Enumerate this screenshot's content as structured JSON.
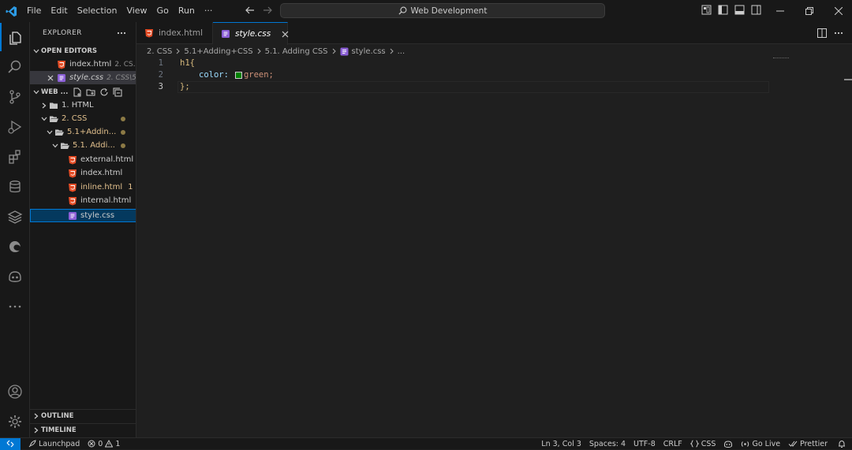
{
  "titlebar": {
    "menu": [
      "File",
      "Edit",
      "Selection",
      "View",
      "Go",
      "Run",
      "···"
    ],
    "search": "Web Development"
  },
  "sidebar": {
    "title": "EXPLORER",
    "open_editors_label": "OPEN EDITORS",
    "open_editors": [
      {
        "name": "index.html",
        "path": "2. CS..."
      },
      {
        "name": "style.css",
        "path": "2. CSS\\5..."
      }
    ],
    "workspace_label": "WEB ...",
    "tree": [
      {
        "label": "1. HTML"
      },
      {
        "label": "2. CSS"
      },
      {
        "label": "5.1+Addin..."
      },
      {
        "label": "5.1. Addi..."
      },
      {
        "label": "external.html"
      },
      {
        "label": "index.html"
      },
      {
        "label": "inline.html",
        "badge": "1"
      },
      {
        "label": "internal.html"
      },
      {
        "label": "style.css"
      }
    ],
    "outline_label": "OUTLINE",
    "timeline_label": "TIMELINE"
  },
  "tabs": [
    {
      "label": "index.html"
    },
    {
      "label": "style.css"
    }
  ],
  "breadcrumb": [
    "2. CSS",
    "5.1+Adding+CSS",
    "5.1. Adding CSS",
    "style.css",
    "..."
  ],
  "editor": {
    "line_numbers": [
      "1",
      "2",
      "3"
    ],
    "line1": "h1{",
    "property": "color:",
    "value": "green;",
    "line3": "};"
  },
  "status": {
    "launchpad": "Launchpad",
    "errors": "0",
    "warnings": "1",
    "position": "Ln 3, Col 3",
    "spaces": "Spaces: 4",
    "encoding": "UTF-8",
    "eol": "CRLF",
    "language": "CSS",
    "golive": "Go Live",
    "prettier": "Prettier"
  },
  "colors": {
    "accent": "#0078d4",
    "html_icon": "#e44d26",
    "css_icon": "#8b5fd6",
    "modified": "#e2c08d",
    "swatch": "#008000"
  },
  "icons": [
    "vscode-logo-icon",
    "files-icon",
    "search-icon",
    "source-control-icon",
    "run-debug-icon",
    "extensions-icon",
    "database-icon",
    "layers-icon",
    "edge-icon",
    "copilot-icon",
    "more-icon",
    "account-icon",
    "settings-icon"
  ]
}
